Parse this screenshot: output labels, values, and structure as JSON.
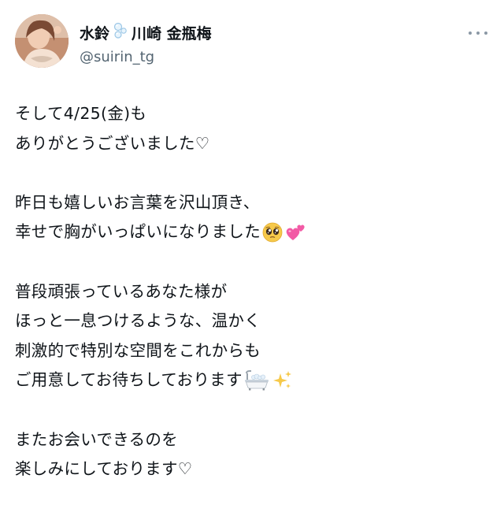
{
  "profile": {
    "display_name_prefix": "水鈴",
    "display_name_suffix": "川崎 金瓶梅",
    "display_name_icon": "bubbles-icon",
    "handle": "@suirin_tg"
  },
  "header": {
    "more_icon": "more-horizontal-icon"
  },
  "tweet": {
    "lines": [
      "そして4/25(金)も",
      "ありがとうございました♡",
      "",
      "昨日も嬉しいお言葉を沢山頂き、",
      "幸せで胸がいっぱいになりました",
      "",
      "普段頑張っているあなた様が",
      "ほっと一息つけるような、温かく",
      "刺激的で特別な空間をこれからも",
      "ご用意してお待ちしております",
      "",
      "またお会いできるのを",
      "楽しみにしております♡"
    ],
    "emojis": {
      "line_4": [
        "pleading-face-icon",
        "two-hearts-icon"
      ],
      "line_9": [
        "bathtub-icon",
        "sparkles-icon"
      ]
    }
  },
  "colors": {
    "text": "#0f1419",
    "handle": "#536471",
    "more_dots": "#8b98a5",
    "heart_pink": "#f25aa5",
    "emoji_yellow": "#f6c94a"
  }
}
